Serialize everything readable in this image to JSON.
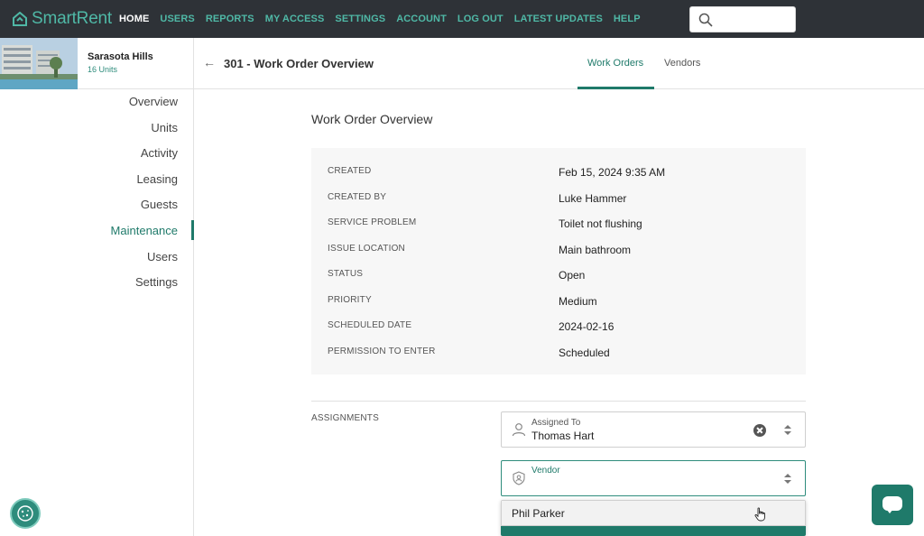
{
  "app": {
    "brand": "SmartRent",
    "accent": "#1f7a6a",
    "nav_bg": "#2e3237"
  },
  "nav": {
    "items": [
      {
        "label": "HOME",
        "active": true
      },
      {
        "label": "USERS"
      },
      {
        "label": "REPORTS"
      },
      {
        "label": "MY ACCESS"
      },
      {
        "label": "SETTINGS"
      },
      {
        "label": "ACCOUNT"
      },
      {
        "label": "LOG OUT"
      },
      {
        "label": "LATEST UPDATES"
      },
      {
        "label": "HELP"
      }
    ],
    "search_icon": "search-icon"
  },
  "property": {
    "name": "Sarasota Hills",
    "units": "16 Units"
  },
  "sidebar": {
    "items": [
      {
        "label": "Overview"
      },
      {
        "label": "Units"
      },
      {
        "label": "Activity"
      },
      {
        "label": "Leasing"
      },
      {
        "label": "Guests"
      },
      {
        "label": "Maintenance",
        "active": true
      },
      {
        "label": "Users"
      },
      {
        "label": "Settings"
      }
    ]
  },
  "header": {
    "back_icon": "←",
    "title": "301 - Work Order Overview",
    "tabs": [
      {
        "label": "Work Orders",
        "active": true
      },
      {
        "label": "Vendors"
      }
    ]
  },
  "overview": {
    "title": "Work Order Overview",
    "rows": [
      {
        "label": "CREATED",
        "value": "Feb 15, 2024 9:35 AM"
      },
      {
        "label": "CREATED BY",
        "value": "Luke Hammer"
      },
      {
        "label": "SERVICE PROBLEM",
        "value": "Toilet not flushing"
      },
      {
        "label": "ISSUE LOCATION",
        "value": "Main bathroom"
      },
      {
        "label": "STATUS",
        "value": "Open"
      },
      {
        "label": "PRIORITY",
        "value": "Medium"
      },
      {
        "label": "SCHEDULED DATE",
        "value": "2024-02-16"
      },
      {
        "label": "PERMISSION TO ENTER",
        "value": "Scheduled"
      }
    ]
  },
  "assignments": {
    "label": "ASSIGNMENTS",
    "assigned_to": {
      "label": "Assigned To",
      "value": "Thomas Hart"
    },
    "vendor": {
      "label": "Vendor",
      "value": ""
    },
    "dropdown_options": [
      "Phil Parker"
    ]
  }
}
